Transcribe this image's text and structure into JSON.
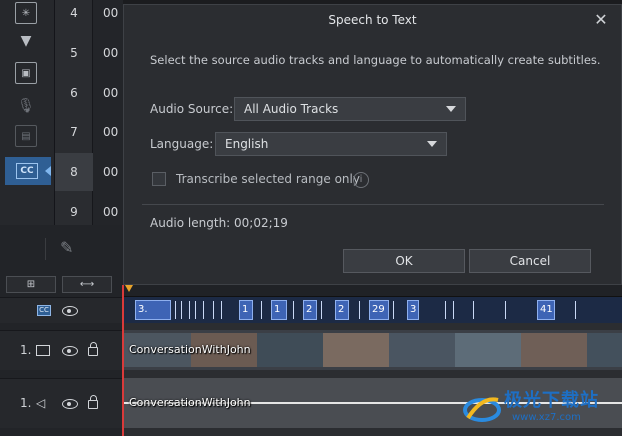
{
  "track_rows": [
    {
      "num": "4",
      "time": "00"
    },
    {
      "num": "5",
      "time": "00"
    },
    {
      "num": "6",
      "time": "00"
    },
    {
      "num": "7",
      "time": "00"
    },
    {
      "num": "8",
      "time": "00"
    },
    {
      "num": "9",
      "time": "00"
    }
  ],
  "rail": {
    "cc_label": "CC"
  },
  "left_buttons": {
    "btn_a_icon": "⊞",
    "btn_b_icon": "⟷"
  },
  "tracks": {
    "subtitle_badge": "CC",
    "video_label": "1.",
    "audio_label": "1."
  },
  "timeline": {
    "subtitles": [
      "3.",
      "1",
      "1",
      "2",
      "2",
      "29",
      "3",
      "41"
    ],
    "video_clip": "ConversationWithJohn",
    "audio_clip": "ConversationWithJohn"
  },
  "dialog": {
    "title": "Speech to Text",
    "description": "Select the source audio tracks and language to automatically create subtitles.",
    "audio_source_label": "Audio Source:",
    "audio_source_value": "All Audio Tracks",
    "language_label": "Language:",
    "language_value": "English",
    "checkbox_label": "Transcribe selected range only",
    "audio_length": "Audio length: 00;02;19",
    "ok_label": "OK",
    "cancel_label": "Cancel"
  },
  "watermark": {
    "text": "极光下载站",
    "url": "www.xz7.com"
  },
  "colors": {
    "accent": "#2f5f94",
    "subtitle": "#3e64b5",
    "playhead": "#d93a3a"
  }
}
